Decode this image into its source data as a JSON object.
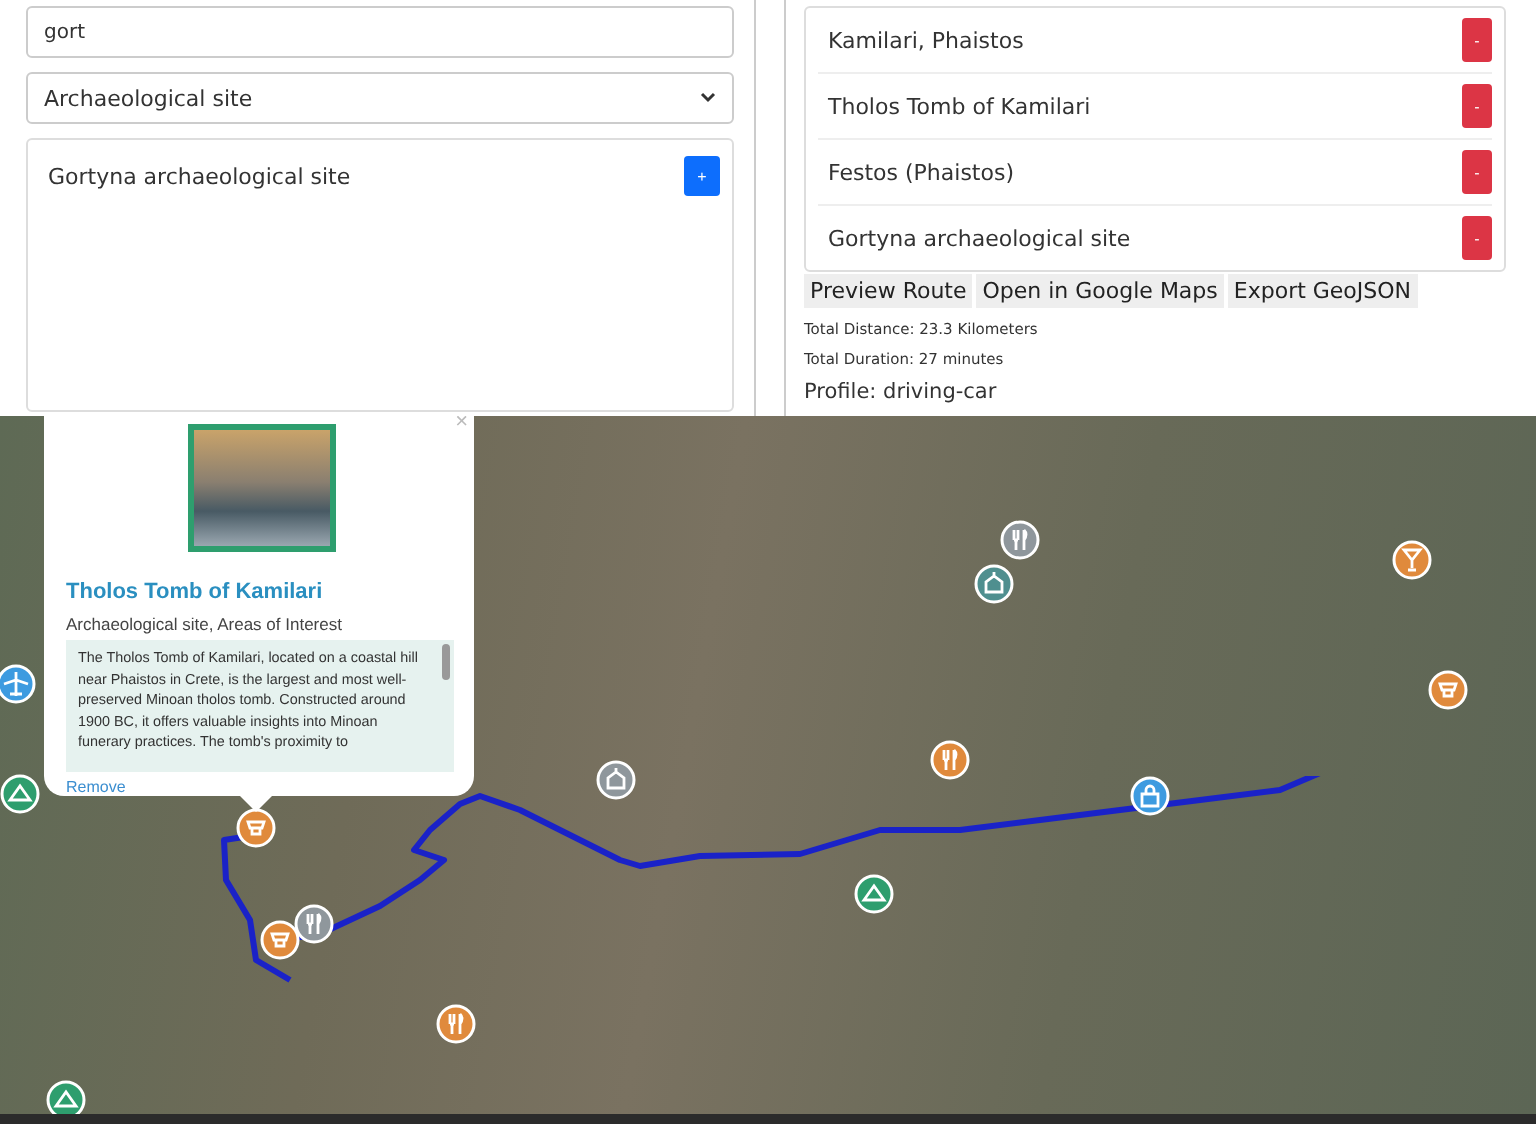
{
  "search": {
    "value": "gort"
  },
  "category": {
    "value": "Archaeological site"
  },
  "results": [
    {
      "name": "Gortyna archaeological site",
      "button": "+"
    }
  ],
  "route_stops": [
    {
      "name": "Kamilari, Phaistos",
      "button": "-"
    },
    {
      "name": "Tholos Tomb of Kamilari",
      "button": "-"
    },
    {
      "name": "Festos (Phaistos)",
      "button": "-"
    },
    {
      "name": "Gortyna archaeological site",
      "button": "-"
    }
  ],
  "actions": [
    "Preview Route",
    "Open in Google Maps",
    "Export GeoJSON"
  ],
  "total_distance": "Total Distance: 23.3 Kilometers",
  "total_duration": "Total Duration: 27 minutes",
  "profile": "Profile: driving-car",
  "popup": {
    "close": "×",
    "title": "Tholos Tomb of Kamilari",
    "subtitle": "Archaeological site, Areas of Interest",
    "description": "The Tholos Tomb of Kamilari, located on a coastal hill near Phaistos in Crete, is the largest and most well-preserved Minoan tholos tomb. Constructed around 1900 BC, it offers valuable insights into Minoan funerary practices. The tomb's proximity to",
    "remove": "Remove"
  },
  "markers": [
    {
      "kind": "sight",
      "color": "#e08a3c"
    },
    {
      "kind": "sight",
      "color": "#e08a3c"
    },
    {
      "kind": "food",
      "color": "#e08a3c"
    },
    {
      "kind": "drink",
      "color": "#e08a3c"
    },
    {
      "kind": "sight",
      "color": "#e08a3c"
    },
    {
      "kind": "food",
      "color": "#e08a3c"
    },
    {
      "kind": "food",
      "color": "#8f979c"
    },
    {
      "kind": "church",
      "color": "#8f979c"
    },
    {
      "kind": "food",
      "color": "#8f979c"
    },
    {
      "kind": "church",
      "color": "#4f8f8f"
    },
    {
      "kind": "park",
      "color": "#2e9e6e"
    },
    {
      "kind": "shop",
      "color": "#3d9be0"
    },
    {
      "kind": "airport",
      "color": "#3d9be0"
    },
    {
      "kind": "park",
      "color": "#2e9e6e"
    },
    {
      "kind": "park",
      "color": "#2e9e6e"
    }
  ]
}
